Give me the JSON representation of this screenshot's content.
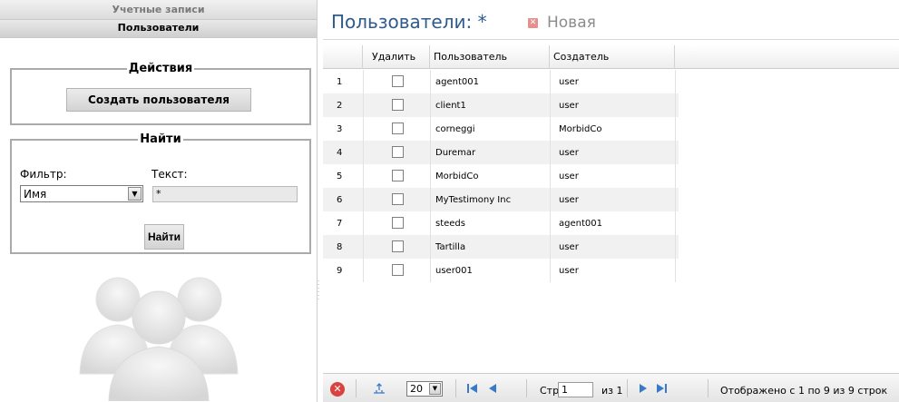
{
  "sidebar": {
    "accounts_header": "Учетные записи",
    "users_header": "Пользователи",
    "actions": {
      "legend": "Действия",
      "create_user_button": "Создать пользователя"
    },
    "find": {
      "legend": "Найти",
      "filter_label": "Фильтр:",
      "text_label": "Текст:",
      "filter_value": "Имя",
      "text_value": "*",
      "find_button": "Найти"
    },
    "illustration_icon": "users-group-icon"
  },
  "main": {
    "title": "Пользователи: *",
    "new_tab": "Новая",
    "table": {
      "columns": [
        "",
        "Удалить",
        "Пользователь",
        "Создатель"
      ],
      "rows": [
        {
          "num": "1",
          "user": "agent001",
          "creator": "user",
          "checked": false
        },
        {
          "num": "2",
          "user": "client1",
          "creator": "user",
          "checked": false
        },
        {
          "num": "3",
          "user": "corneggi",
          "creator": "MorbidCo",
          "checked": false
        },
        {
          "num": "4",
          "user": "Duremar",
          "creator": "user",
          "checked": false
        },
        {
          "num": "5",
          "user": "MorbidCo",
          "creator": "user",
          "checked": false
        },
        {
          "num": "6",
          "user": "MyTestimony Inc",
          "creator": "user",
          "checked": false
        },
        {
          "num": "7",
          "user": "steeds",
          "creator": "agent001",
          "checked": false
        },
        {
          "num": "8",
          "user": "Tartilla",
          "creator": "user",
          "checked": false
        },
        {
          "num": "9",
          "user": "user001",
          "creator": "user",
          "checked": false
        }
      ]
    },
    "toolbar": {
      "page_size": "20",
      "page_label": "Стр.",
      "page_value": "1",
      "of_label": "из 1",
      "display_info": "Отображено с 1 по 9 из 9 строк"
    }
  },
  "colors": {
    "title_blue": "#2e5b8e",
    "row_alt": "#f1f1f1",
    "nav_blue": "#3a78c9",
    "stop_red": "#d9423e"
  }
}
